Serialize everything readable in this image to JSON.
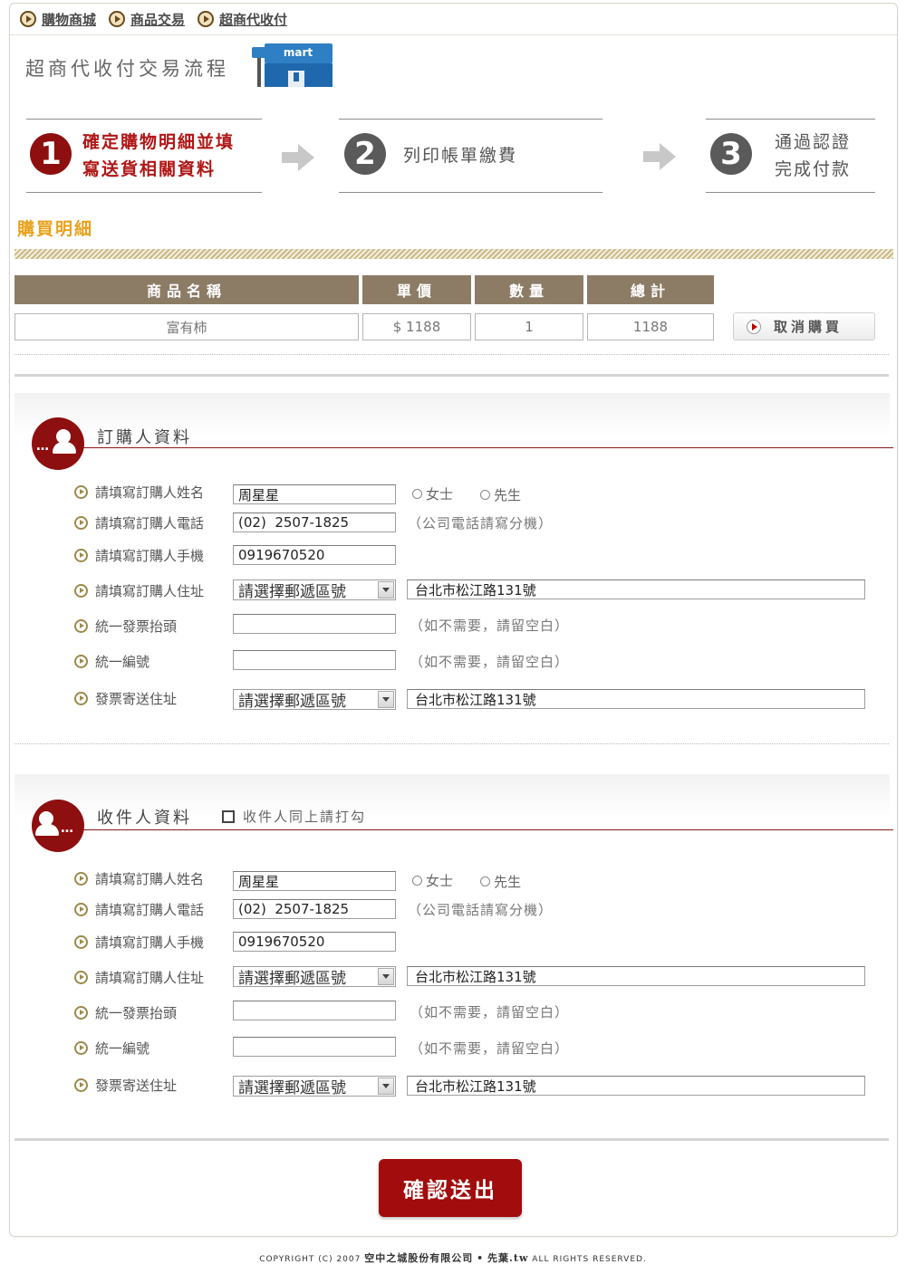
{
  "nav": [
    "購物商城",
    "商品交易",
    "超商代收付"
  ],
  "page_title": "超商代收付交易流程",
  "mart_logo": "mart",
  "steps": [
    {
      "num": "1",
      "line1": "確定購物明細並填",
      "line2": "寫送貨相關資料"
    },
    {
      "num": "2",
      "line1": "列印帳單繳費",
      "line2": ""
    },
    {
      "num": "3",
      "line1": "通過認證",
      "line2": "完成付款"
    }
  ],
  "purchase_title": "購買明細",
  "table": {
    "headers": [
      "商品名稱",
      "單價",
      "數量",
      "總計"
    ],
    "row": {
      "name": "富有柿",
      "price": "$ 1188",
      "qty": "1",
      "total": "1188"
    },
    "cancel": "取消購買"
  },
  "buyer": {
    "title": "訂購人資料",
    "labels": [
      "請填寫訂購人姓名",
      "請填寫訂購人電話",
      "請填寫訂購人手機",
      "請填寫訂購人住址",
      "統一發票抬頭",
      "統一編號",
      "發票寄送住址"
    ],
    "name": "周星星",
    "phone": "(02)  2507-1825",
    "mobile": "0919670520",
    "zip_select": "請選擇郵遞區號",
    "address": "台北市松江路131號",
    "invoice_title": "",
    "tax_id": "",
    "invoice_address": "台北市松江路131號",
    "radio_female": "女士",
    "radio_male": "先生",
    "phone_note": "（公司電話請寫分機）",
    "blank_note": "（如不需要，請留空白）"
  },
  "receiver": {
    "title": "收件人資料",
    "same_checkbox": "收件人同上請打勾",
    "labels": [
      "請填寫訂購人姓名",
      "請填寫訂購人電話",
      "請填寫訂購人手機",
      "請填寫訂購人住址",
      "統一發票抬頭",
      "統一編號",
      "發票寄送住址"
    ],
    "name": "周星星",
    "phone": "(02)  2507-1825",
    "mobile": "0919670520",
    "zip_select": "請選擇郵遞區號",
    "address": "台北市松江路131號",
    "invoice_title": "",
    "tax_id": "",
    "invoice_address": "台北市松江路131號",
    "radio_female": "女士",
    "radio_male": "先生",
    "phone_note": "（公司電話請寫分機）",
    "blank_note": "（如不需要，請留空白）"
  },
  "submit": "確認送出",
  "footer": {
    "prefix": "COPYRIGHT (C) 2007",
    "company": "空中之城股份有限公司",
    "sep": "•",
    "site": "先葉.tw",
    "suffix": "ALL RIGHTS RESERVED."
  },
  "colors": {
    "accent_red": "#a20c0c",
    "header_brown": "#8c7c66",
    "section_gold": "#e8a21c"
  }
}
